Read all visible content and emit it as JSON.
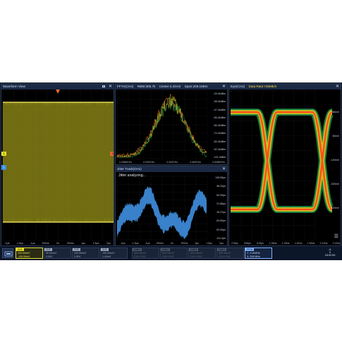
{
  "colors": {
    "trace_yellow": "#e3dc25",
    "fft_orange": "#e26a2b",
    "jitter_blue": "#3f8fe0",
    "eye_hot": "#ff4a1a",
    "eye_mid": "#f2d21c",
    "eye_cool": "#2bd06c",
    "panel_header": "#1b2944"
  },
  "waveform": {
    "title": "Waveform View",
    "x_ticks": [
      "-2µs",
      "-1.5µs",
      "-1µs",
      "-500ns",
      "0s",
      "500ns",
      "1µs",
      "1.5µs",
      "2µs"
    ],
    "marker_left": "1",
    "marker_right": "1",
    "marker_left2": "T"
  },
  "fft": {
    "title": "FFTA(CH4)",
    "rbw": "RBW:305.7k",
    "center": "Center:4.4GHz",
    "span": "Span:209.1MHz",
    "y_ticks": [
      "-29.34dBm",
      "-38.34dBm",
      "-47.34dBm",
      "-56.34dBm",
      "-65.34dBm",
      "-74.34dBm",
      "-83.34dBm",
      "-92.34dBm",
      "-101.3dBm"
    ],
    "x_ticks": [
      "4.2888GHz",
      "4.340GHz",
      "4.400GHz",
      "4.460GHz",
      "4.5088GHz"
    ]
  },
  "jitter": {
    "title": "Jitter Track(CH1)",
    "status": "Jitter analyzing...",
    "y_ticks": [
      "136.55ps",
      "98.32ps",
      "60.09ps",
      "21.86ps",
      "-16.37ps",
      "-54.60ps",
      "-92.83ps",
      "-131.0ps"
    ],
    "x_ticks": [
      "-2µs",
      "-1.5µs",
      "-1µs",
      "-500ns",
      "0s",
      "500ns",
      "1µs",
      "1.5µs",
      "2µs"
    ]
  },
  "eye": {
    "title": "Eye(CH1)",
    "data_rate": "Data Rate:748Mb/s",
    "y_ticks": [
      "280mV",
      "80mV",
      "-120mV",
      "-320mV",
      "-520mV"
    ],
    "x_ticks": [
      "276ps",
      "546ps",
      "815ps",
      "1.08ns",
      "1.35ns",
      "1.62ns",
      "1.89ns",
      "2.16ns",
      "2.43ns"
    ]
  },
  "channels": [
    {
      "tag": "CH1",
      "l1": "200.00mV/",
      "l2": "-120.00mV",
      "state": "active"
    },
    {
      "tag": "CH2",
      "l1": "50.00mV/",
      "l2": "0.00V",
      "state": "normal"
    },
    {
      "tag": "CH3",
      "l1": "100.00mV/",
      "l2": "0.00V",
      "state": "normal"
    },
    {
      "tag": "CH4",
      "l1": "100.00mV/",
      "l2": "1.42mV",
      "state": "normal"
    },
    {
      "tag": "Math1",
      "l1": "500.00mV/",
      "l2": "CH1+CH2",
      "state": "dim"
    },
    {
      "tag": "Math2",
      "l1": "500.00mV/",
      "l2": "CH1+CH2",
      "state": "dim"
    },
    {
      "tag": "Math3",
      "l1": "500.00mV/",
      "l2": "CH1+CH2",
      "state": "dim"
    },
    {
      "tag": "Math4",
      "l1": "500.00mV/",
      "l2": "CH1+CH2",
      "state": "dim"
    },
    {
      "tag": "FFTA",
      "l1": "C: 4.40GHz",
      "l2": "S: 209 MHz",
      "state": "fft"
    }
  ],
  "clock": {
    "top": "-0-",
    "mid": "0",
    "time": "18:02:53"
  }
}
